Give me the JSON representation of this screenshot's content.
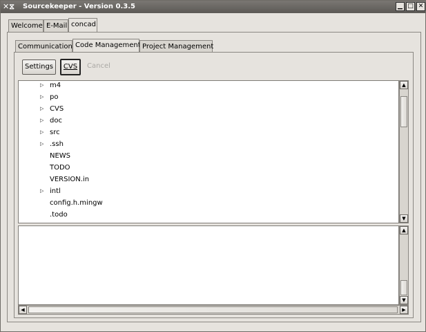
{
  "window": {
    "title": "Sourcekeeper - Version 0.3.5",
    "controls": [
      "minimize",
      "maximize",
      "close"
    ]
  },
  "main_tabs": [
    {
      "label": "Welcome",
      "active": false
    },
    {
      "label": "E-Mail",
      "active": false
    },
    {
      "label": "concad",
      "active": true
    }
  ],
  "sub_tabs": [
    {
      "label": "Communication",
      "active": false
    },
    {
      "label": "Code Management",
      "active": true
    },
    {
      "label": "Project Management",
      "active": false
    }
  ],
  "toolbar": {
    "settings_label": "Settings",
    "cvs_label": "CVS",
    "cancel_label": "Cancel"
  },
  "tree": {
    "items": [
      {
        "label": "m4",
        "expandable": true
      },
      {
        "label": "po",
        "expandable": true
      },
      {
        "label": "CVS",
        "expandable": true
      },
      {
        "label": "doc",
        "expandable": true
      },
      {
        "label": "src",
        "expandable": true
      },
      {
        "label": ".ssh",
        "expandable": true
      },
      {
        "label": "NEWS",
        "expandable": false
      },
      {
        "label": "TODO",
        "expandable": false
      },
      {
        "label": "VERSION.in",
        "expandable": false
      },
      {
        "label": "intl",
        "expandable": true
      },
      {
        "label": "config.h.mingw",
        "expandable": false
      },
      {
        "label": ".todo",
        "expandable": false
      }
    ]
  },
  "output": {
    "text": ""
  }
}
